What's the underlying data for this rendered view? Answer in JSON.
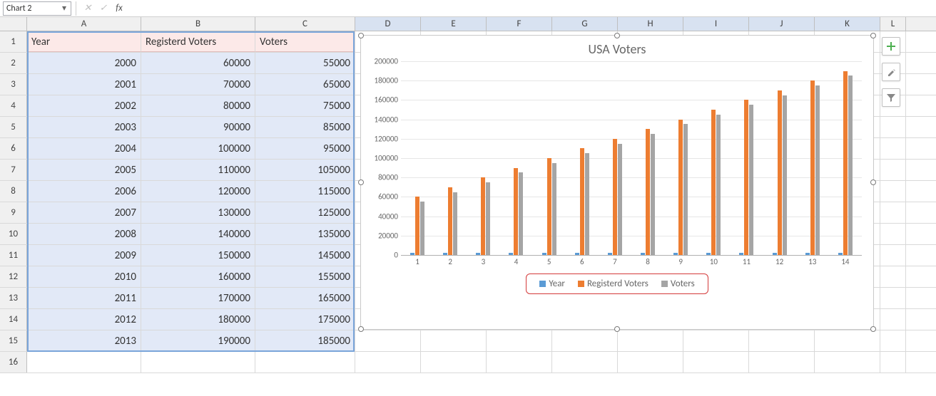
{
  "formula_bar": {
    "name_box": "Chart 2"
  },
  "columns": [
    "A",
    "B",
    "C",
    "D",
    "E",
    "F",
    "G",
    "H",
    "I",
    "J",
    "K",
    "L"
  ],
  "header_row": {
    "A": "Year",
    "B": "Registerd Voters",
    "C": "Voters"
  },
  "rows": [
    {
      "n": "1"
    },
    {
      "n": "2",
      "A": "2000",
      "B": "60000",
      "C": "55000"
    },
    {
      "n": "3",
      "A": "2001",
      "B": "70000",
      "C": "65000"
    },
    {
      "n": "4",
      "A": "2002",
      "B": "80000",
      "C": "75000"
    },
    {
      "n": "5",
      "A": "2003",
      "B": "90000",
      "C": "85000"
    },
    {
      "n": "6",
      "A": "2004",
      "B": "100000",
      "C": "95000"
    },
    {
      "n": "7",
      "A": "2005",
      "B": "110000",
      "C": "105000"
    },
    {
      "n": "8",
      "A": "2006",
      "B": "120000",
      "C": "115000"
    },
    {
      "n": "9",
      "A": "2007",
      "B": "130000",
      "C": "125000"
    },
    {
      "n": "10",
      "A": "2008",
      "B": "140000",
      "C": "135000"
    },
    {
      "n": "11",
      "A": "2009",
      "B": "150000",
      "C": "145000"
    },
    {
      "n": "12",
      "A": "2010",
      "B": "160000",
      "C": "155000"
    },
    {
      "n": "13",
      "A": "2011",
      "B": "170000",
      "C": "165000"
    },
    {
      "n": "14",
      "A": "2012",
      "B": "180000",
      "C": "175000"
    },
    {
      "n": "15",
      "A": "2013",
      "B": "190000",
      "C": "185000"
    },
    {
      "n": "16"
    }
  ],
  "side_icons": {
    "add": "plus-icon",
    "style": "brush-icon",
    "filter": "funnel-icon"
  },
  "chart_data": {
    "type": "bar",
    "title": "USA Voters",
    "xlabel": "",
    "ylabel": "",
    "ylim": [
      0,
      200000
    ],
    "yticks": [
      0,
      20000,
      40000,
      60000,
      80000,
      100000,
      120000,
      140000,
      160000,
      180000,
      200000
    ],
    "categories": [
      "1",
      "2",
      "3",
      "4",
      "5",
      "6",
      "7",
      "8",
      "9",
      "10",
      "11",
      "12",
      "13",
      "14"
    ],
    "series": [
      {
        "name": "Year",
        "color": "#5b9bd5",
        "values": [
          2000,
          2001,
          2002,
          2003,
          2004,
          2005,
          2006,
          2007,
          2008,
          2009,
          2010,
          2011,
          2012,
          2013
        ]
      },
      {
        "name": "Registerd Voters",
        "color": "#ed7d31",
        "values": [
          60000,
          70000,
          80000,
          90000,
          100000,
          110000,
          120000,
          130000,
          140000,
          150000,
          160000,
          170000,
          180000,
          190000
        ]
      },
      {
        "name": "Voters",
        "color": "#a5a5a5",
        "values": [
          55000,
          65000,
          75000,
          85000,
          95000,
          105000,
          115000,
          125000,
          135000,
          145000,
          155000,
          165000,
          175000,
          185000
        ]
      }
    ],
    "legend_highlight": true
  }
}
